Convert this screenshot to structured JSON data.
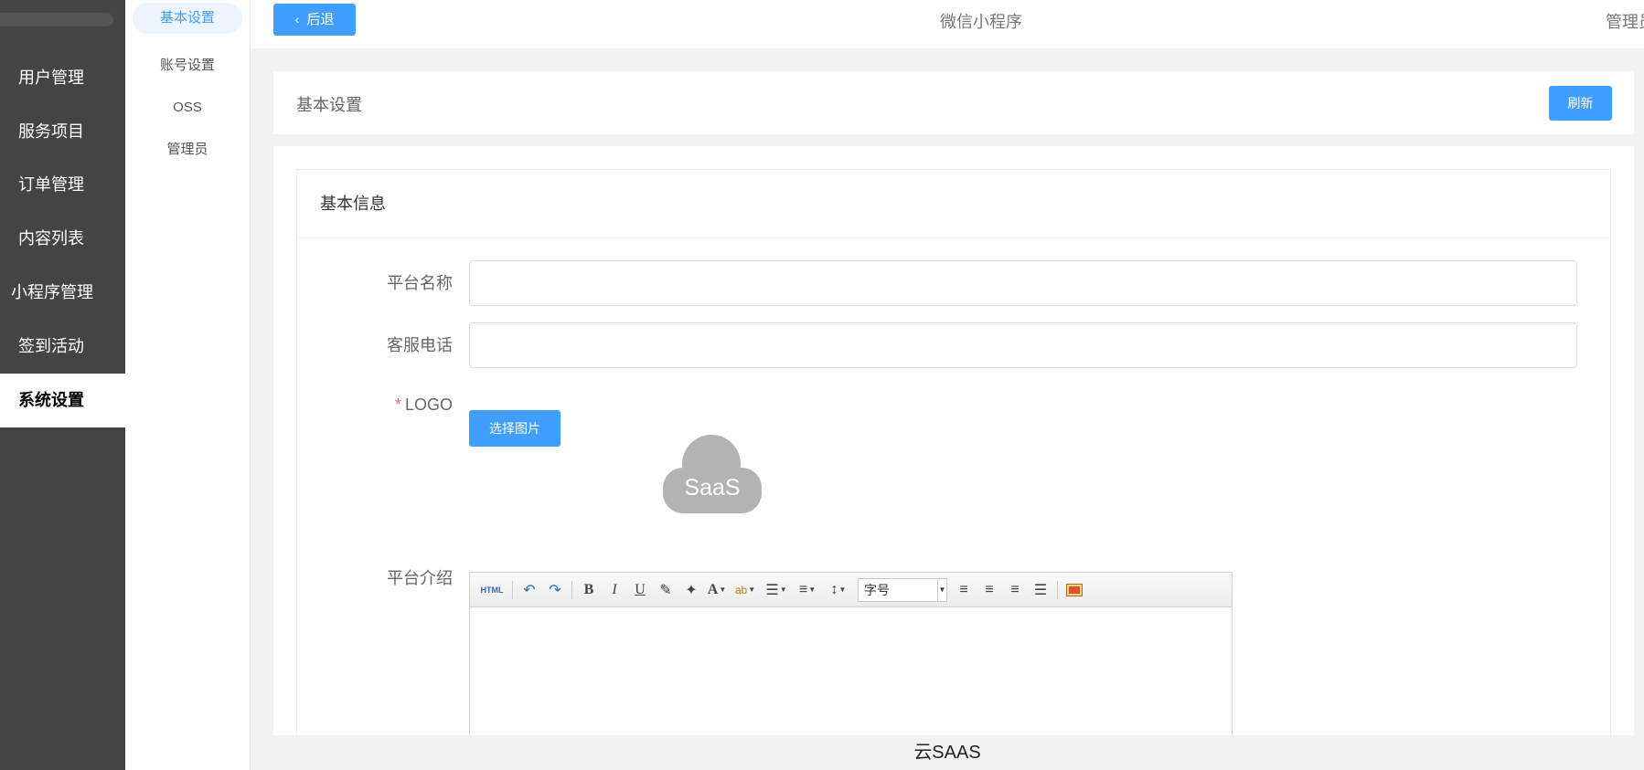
{
  "sidebar": {
    "items": [
      {
        "label": "用户管理"
      },
      {
        "label": "服务项目"
      },
      {
        "label": "订单管理"
      },
      {
        "label": "内容列表"
      },
      {
        "label": "小程序管理"
      },
      {
        "label": "签到活动"
      },
      {
        "label": "系统设置",
        "active": true
      }
    ]
  },
  "subnav": {
    "items": [
      {
        "label": "基本设置",
        "active": true
      },
      {
        "label": "账号设置"
      },
      {
        "label": "OSS"
      },
      {
        "label": "管理员"
      }
    ]
  },
  "topbar": {
    "back_label": "后退",
    "center_title": "微信小程序",
    "right_label": "管理员"
  },
  "header": {
    "title": "基本设置",
    "refresh_label": "刷新"
  },
  "form": {
    "section_title": "基本信息",
    "platform_name_label": "平台名称",
    "platform_name_value": "",
    "service_phone_label": "客服电话",
    "service_phone_value": "",
    "logo_label": "LOGO",
    "logo_required_mark": "*",
    "choose_image_label": "选择图片",
    "logo_text": "SaaS",
    "intro_label": "平台介绍",
    "editor": {
      "html_label": "HTML",
      "font_size_placeholder": "字号"
    }
  },
  "footer": {
    "text": "云SAAS"
  },
  "colors": {
    "primary": "#409eff",
    "sidebar_bg": "#444444",
    "required": "#f56c6c"
  }
}
